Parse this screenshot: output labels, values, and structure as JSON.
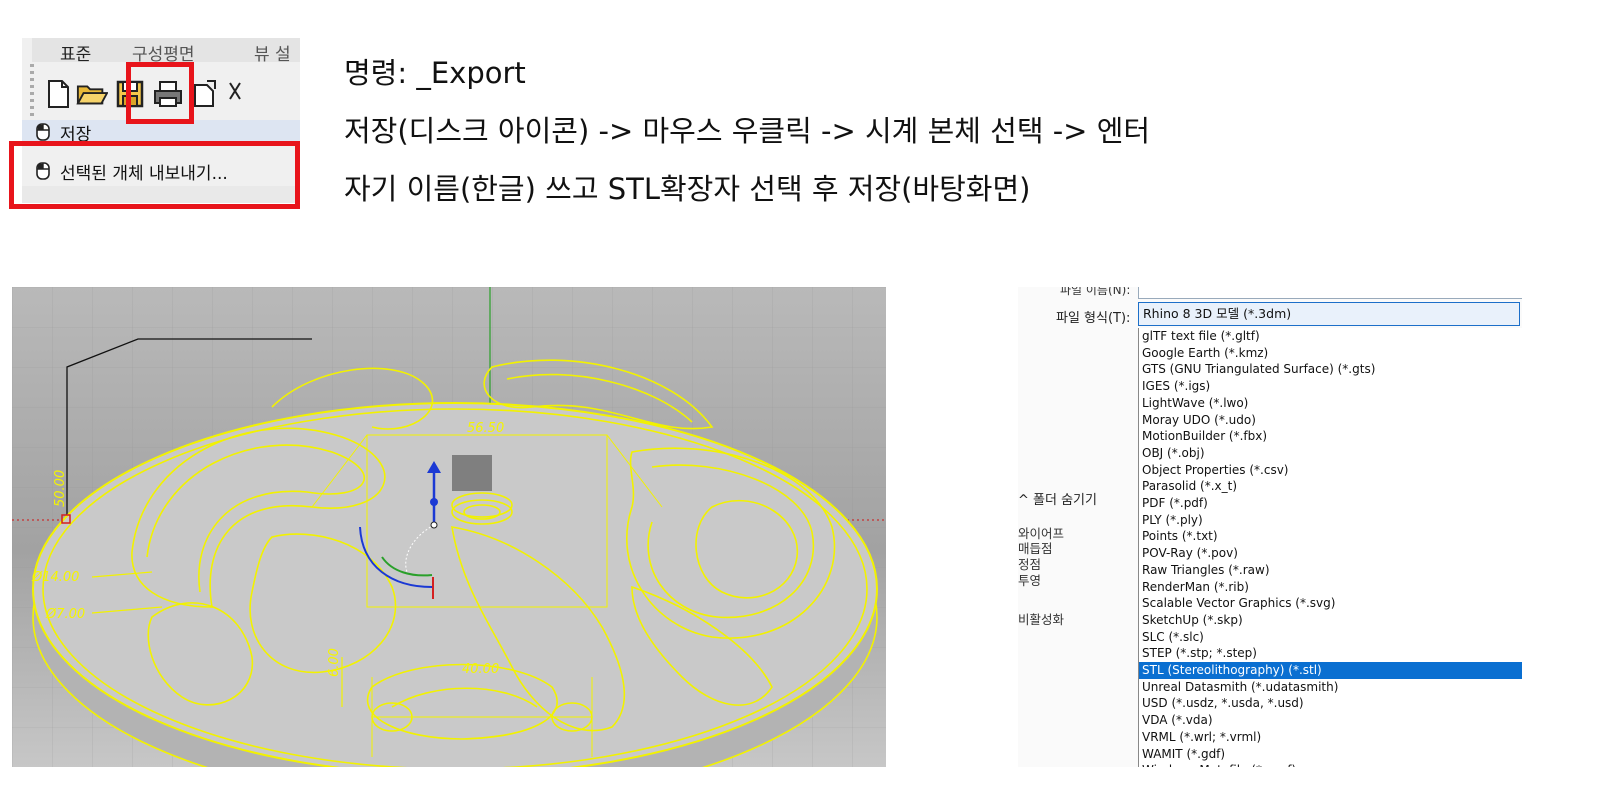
{
  "toolbar": {
    "tabs": [
      "표준",
      "구성평면",
      "뷰 설"
    ],
    "menu_save_label": "저장",
    "menu_export_label": "선택된 개체 내보내기...",
    "highlight_color": "#e8141b",
    "icons": [
      "new-file-icon",
      "open-folder-icon",
      "save-disk-icon",
      "print-icon",
      "attach-icon",
      "cut-icon"
    ]
  },
  "instructions": {
    "line1": "명령: _Export",
    "line2": "저장(디스크 아이콘) -> 마우스 우클릭 -> 시계 본체 선택 -> 엔터",
    "line3": "자기 이름(한글)  쓰고 STL확장자 선택 후 저장(바탕화면)"
  },
  "viewport": {
    "dimensions": [
      "56.50",
      "50.00",
      "Ø14.00",
      "Ø7.00",
      "6.00",
      "40.00"
    ],
    "wire_color": "#f2f200"
  },
  "dialog": {
    "file_name_label": "파일 이름(N):",
    "file_type_label": "파일 형식(T):",
    "selected_type": "Rhino 8 3D 모델 (*.3dm)",
    "folder_toggle": "^ 폴더 숨기기",
    "side_labels": [
      "와이어프",
      "매듭점",
      "정점",
      "투영",
      "비활성화"
    ],
    "options": [
      "glTF text file (*.gltf)",
      "Google Earth (*.kmz)",
      "GTS (GNU Triangulated Surface) (*.gts)",
      "IGES (*.igs)",
      "LightWave (*.lwo)",
      "Moray UDO (*.udo)",
      "MotionBuilder (*.fbx)",
      "OBJ (*.obj)",
      "Object Properties (*.csv)",
      "Parasolid (*.x_t)",
      "PDF (*.pdf)",
      "PLY (*.ply)",
      "Points (*.txt)",
      "POV-Ray (*.pov)",
      "Raw Triangles (*.raw)",
      "RenderMan (*.rib)",
      "Scalable Vector Graphics (*.svg)",
      "SketchUp (*.skp)",
      "SLC (*.slc)",
      "STEP (*.stp; *.step)",
      "STL (Stereolithography) (*.stl)",
      "Unreal Datasmith (*.udatasmith)",
      "USD (*.usdz, *.usda, *.usd)",
      "VDA (*.vda)",
      "VRML (*.wrl; *.vrml)",
      "WAMIT (*.gdf)",
      "Windows Metafile (*.wmf)"
    ],
    "selected_index": 20,
    "selection_color": "#0a6fd1"
  }
}
